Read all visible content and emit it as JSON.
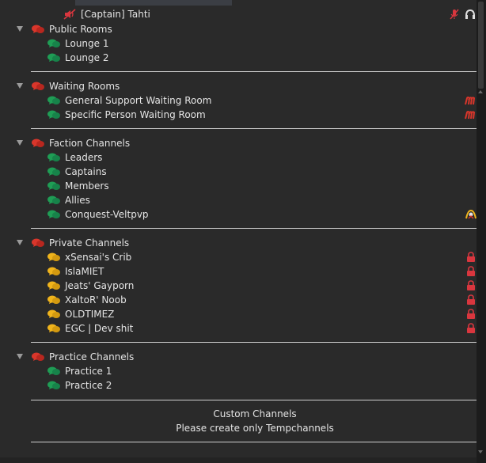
{
  "colors": {
    "background": "#2a2a2a",
    "text": "#e4e4e4",
    "separator": "#cfcfcf",
    "category_bubble": "#d9362b",
    "channel_bubble_green": "#1f9d55",
    "channel_bubble_yellow": "#f0b41c",
    "lock": "#d9363e",
    "muted": "#d9363e"
  },
  "client": {
    "name": "[Captain] Tahti",
    "icons": [
      "speaker-muted-icon",
      "mic-muted-icon",
      "headset-icon"
    ]
  },
  "categories": [
    {
      "name": "Public Rooms",
      "channels": [
        {
          "name": "Lounge 1",
          "bubble": "green"
        },
        {
          "name": "Lounge 2",
          "bubble": "green"
        }
      ]
    },
    {
      "name": "Waiting Rooms",
      "channels": [
        {
          "name": "General Support Waiting Room",
          "bubble": "green",
          "icon": "moderated-icon"
        },
        {
          "name": "Specific Person Waiting Room",
          "bubble": "green",
          "icon": "moderated-icon"
        }
      ]
    },
    {
      "name": "Faction Channels",
      "channels": [
        {
          "name": "Leaders",
          "bubble": "green"
        },
        {
          "name": "Captains",
          "bubble": "green"
        },
        {
          "name": "Members",
          "bubble": "green"
        },
        {
          "name": "Allies",
          "bubble": "green"
        },
        {
          "name": "Conquest-Veltpvp",
          "bubble": "green",
          "icon": "server-group-icon"
        }
      ]
    },
    {
      "name": "Private Channels",
      "channels": [
        {
          "name": "xSensai's Crib",
          "bubble": "yellow",
          "icon": "lock-icon"
        },
        {
          "name": "IslaMIET",
          "bubble": "yellow",
          "icon": "lock-icon"
        },
        {
          "name": "Jeats' Gayporn",
          "bubble": "yellow",
          "icon": "lock-icon"
        },
        {
          "name": "XaltoR' Noob",
          "bubble": "yellow",
          "icon": "lock-icon"
        },
        {
          "name": "OLDTIMEZ",
          "bubble": "yellow",
          "icon": "lock-icon"
        },
        {
          "name": "EGC | Dev shit",
          "bubble": "yellow",
          "icon": "lock-icon"
        }
      ]
    },
    {
      "name": "Practice Channels",
      "channels": [
        {
          "name": "Practice 1",
          "bubble": "green"
        },
        {
          "name": "Practice 2",
          "bubble": "green"
        }
      ]
    }
  ],
  "footer": {
    "line1": "Custom Channels",
    "line2": "Please create only Tempchannels"
  }
}
